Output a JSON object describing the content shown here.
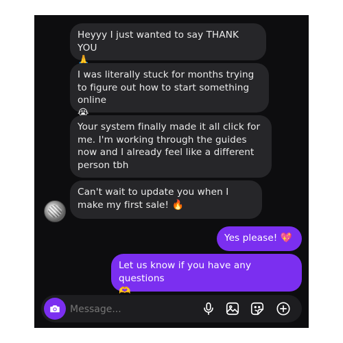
{
  "conversation": {
    "messages": [
      {
        "direction": "incoming",
        "text": "Heyyy I just wanted to say THANK YOU",
        "emoji": "🙏"
      },
      {
        "direction": "incoming",
        "text": "I was literally stuck for months trying to figure out how to start something online",
        "emoji": "😭"
      },
      {
        "direction": "incoming",
        "text": "Your system finally made it all click for me. I'm working through the guides now and I already feel like a different person tbh",
        "emoji": ""
      },
      {
        "direction": "incoming",
        "text": "Can't wait to update you when I make my first sale!",
        "emoji": "🔥"
      },
      {
        "direction": "outgoing",
        "text": "Yes please!",
        "emoji": "💖"
      },
      {
        "direction": "outgoing",
        "text": "Let us know if you have any questions",
        "emoji": "🫶"
      }
    ]
  },
  "composer": {
    "placeholder": "Message...",
    "icons": [
      "camera-icon",
      "microphone-icon",
      "gallery-icon",
      "sticker-icon",
      "add-icon"
    ]
  },
  "colors": {
    "background": "#0d0d0f",
    "incoming_bubble": "#262629",
    "outgoing_bubble": "#7b2ff0",
    "accent": "#7b2ff0"
  }
}
